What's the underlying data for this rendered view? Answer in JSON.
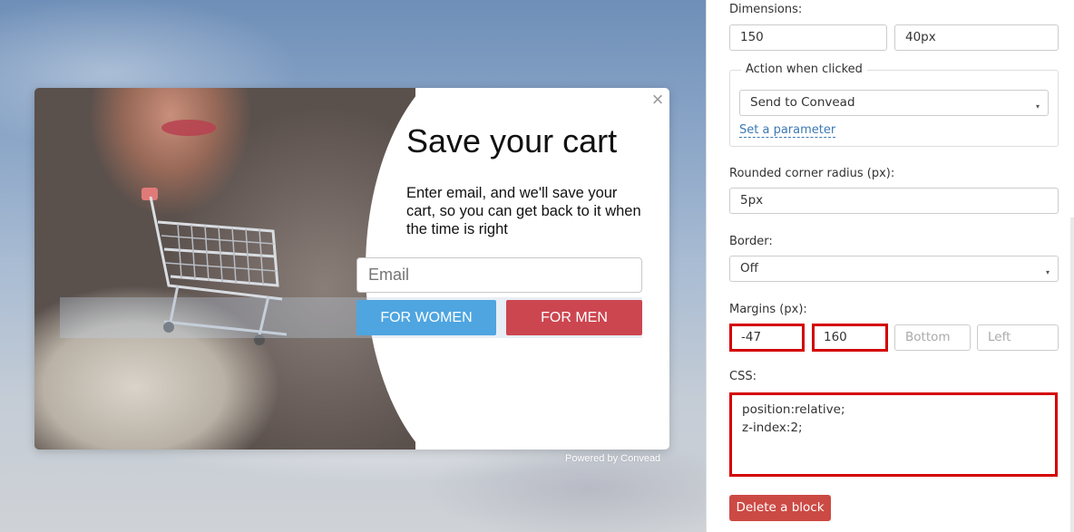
{
  "popup": {
    "title": "Save your cart",
    "description": "Enter email, and we'll save your cart, so you can get back to it when the time is right",
    "email_placeholder": "Email",
    "button_women": "FOR WOMEN",
    "button_men": "FOR MEN",
    "close_icon": "×",
    "powered_by": "Powered by Convead",
    "colors": {
      "women_button": "#4ea5e0",
      "men_button": "#cc4650"
    }
  },
  "settings": {
    "dimensions_label": "Dimensions:",
    "width_value": "150",
    "height_value": "40px",
    "action_legend": "Action when clicked",
    "action_selected": "Send to Convead",
    "set_parameter_link": "Set a parameter",
    "radius_label": "Rounded corner radius (px):",
    "radius_value": "5px",
    "border_label": "Border:",
    "border_selected": "Off",
    "margins_label": "Margins (px):",
    "margin_top": "-47",
    "margin_right": "160",
    "margin_bottom_placeholder": "Bottom",
    "margin_left_placeholder": "Left",
    "css_label": "CSS:",
    "css_value": "position:relative;\nz-index:2;",
    "delete_button": "Delete a block",
    "caret_icon": "▾",
    "colors": {
      "highlight": "#d40000",
      "delete": "#cc4a44",
      "link": "#3b78b5"
    }
  }
}
